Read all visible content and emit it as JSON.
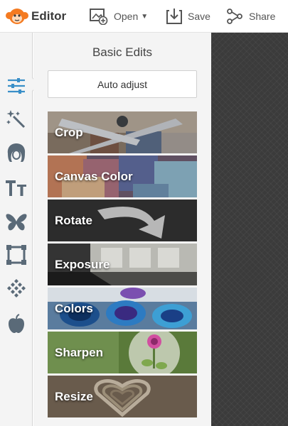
{
  "header": {
    "brand": "Editor",
    "open_label": "Open",
    "save_label": "Save",
    "share_label": "Share"
  },
  "rail": {
    "tools": [
      "sliders-icon",
      "magic-wand-icon",
      "hair-icon",
      "text-icon",
      "butterfly-icon",
      "frame-icon",
      "texture-icon",
      "apple-icon"
    ],
    "active": "sliders-icon"
  },
  "panel": {
    "title": "Basic Edits",
    "auto_adjust": "Auto adjust",
    "items": [
      {
        "label": "Crop"
      },
      {
        "label": "Canvas Color"
      },
      {
        "label": "Rotate"
      },
      {
        "label": "Exposure"
      },
      {
        "label": "Colors"
      },
      {
        "label": "Sharpen"
      },
      {
        "label": "Resize"
      }
    ]
  },
  "colors": {
    "accent": "#f47a20",
    "icon": "#5a6a78",
    "active_icon": "#3a8fc8",
    "canvas": "#3b3b3b"
  }
}
